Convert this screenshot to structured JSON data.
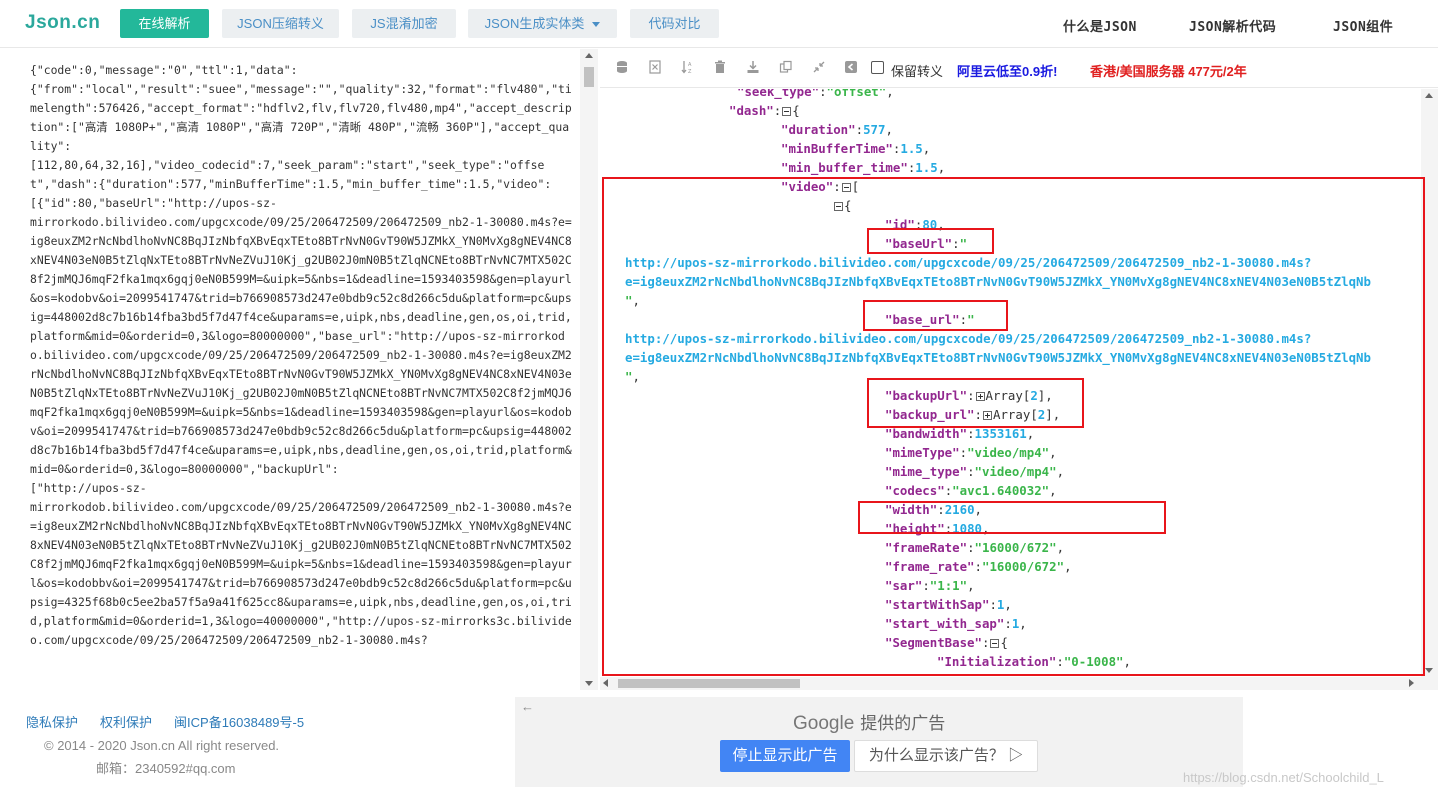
{
  "header": {
    "logo": "Json.cn",
    "nav": [
      {
        "label": "在线解析"
      },
      {
        "label": "JSON压缩转义"
      },
      {
        "label": "JS混淆加密"
      },
      {
        "label": "JSON生成实体类"
      },
      {
        "label": "代码对比"
      }
    ],
    "right_nav": [
      "什么是JSON",
      "JSON解析代码",
      "JSON组件"
    ]
  },
  "raw_json": "{\"code\":0,\"message\":\"0\",\"ttl\":1,\"data\":\n{\"from\":\"local\",\"result\":\"suee\",\"message\":\"\",\"quality\":32,\"format\":\"flv480\",\"timelength\":576426,\"accept_format\":\"hdflv2,flv,flv720,flv480,mp4\",\"accept_description\":[\"高清 1080P+\",\"高清 1080P\",\"高清 720P\",\"清晰 480P\",\"流畅 360P\"],\"accept_quality\":\n[112,80,64,32,16],\"video_codecid\":7,\"seek_param\":\"start\",\"seek_type\":\"offset\",\"dash\":{\"duration\":577,\"minBufferTime\":1.5,\"min_buffer_time\":1.5,\"video\":\n[{\"id\":80,\"baseUrl\":\"http://upos-sz-\nmirrorkodo.bilivideo.com/upgcxcode/09/25/206472509/206472509_nb2-1-30080.m4s?e=ig8euxZM2rNcNbdlhoNvNC8BqJIzNbfqXBvEqxTEto8BTrNvN0GvT90W5JZMkX_YN0MvXg8gNEV4NC8xNEV4N03eN0B5tZlqNxTEto8BTrNvNeZVuJ10Kj_g2UB02J0mN0B5tZlqNCNEto8BTrNvNC7MTX502C8f2jmMQJ6mqF2fka1mqx6gqj0eN0B599M=&uipk=5&nbs=1&deadline=1593403598&gen=playurl&os=kodobv&oi=2099541747&trid=b766908573d247e0bdb9c52c8d266c5du&platform=pc&upsig=448002d8c7b16b14fba3bd5f7d47f4ce&uparams=e,uipk,nbs,deadline,gen,os,oi,trid,platform&mid=0&orderid=0,3&logo=80000000\",\"base_url\":\"http://upos-sz-mirrorkodo.bilivideo.com/upgcxcode/09/25/206472509/206472509_nb2-1-30080.m4s?e=ig8euxZM2rNcNbdlhoNvNC8BqJIzNbfqXBvEqxTEto8BTrNvN0GvT90W5JZMkX_YN0MvXg8gNEV4NC8xNEV4N03eN0B5tZlqNxTEto8BTrNvNeZVuJ10Kj_g2UB02J0mN0B5tZlqNCNEto8BTrNvNC7MTX502C8f2jmMQJ6mqF2fka1mqx6gqj0eN0B599M=&uipk=5&nbs=1&deadline=1593403598&gen=playurl&os=kodobv&oi=2099541747&trid=b766908573d247e0bdb9c52c8d266c5du&platform=pc&upsig=448002d8c7b16b14fba3bd5f7d47f4ce&uparams=e,uipk,nbs,deadline,gen,os,oi,trid,platform&mid=0&orderid=0,3&logo=80000000\",\"backupUrl\":\n[\"http://upos-sz-\nmirrorkodob.bilivideo.com/upgcxcode/09/25/206472509/206472509_nb2-1-30080.m4s?e=ig8euxZM2rNcNbdlhoNvNC8BqJIzNbfqXBvEqxTEto8BTrNvN0GvT90W5JZMkX_YN0MvXg8gNEV4NC8xNEV4N03eN0B5tZlqNxTEto8BTrNvNeZVuJ10Kj_g2UB02J0mN0B5tZlqNCNEto8BTrNvNC7MTX502C8f2jmMQJ6mqF2fka1mqx6gqj0eN0B599M=&uipk=5&nbs=1&deadline=1593403598&gen=playurl&os=kodobbv&oi=2099541747&trid=b766908573d247e0bdb9c52c8d266c5du&platform=pc&upsig=4325f68b0c5ee2ba57f5a9a41f625cc8&uparams=e,uipk,nbs,deadline,gen,os,oi,trid,platform&mid=0&orderid=1,3&logo=40000000\",\"http://upos-sz-mirrorks3c.bilivideo.com/upgcxcode/09/25/206472509/206472509_nb2-1-30080.m4s?",
  "toolbar": {
    "checkbox_label": "保留转义",
    "ad_blue": "阿里云低至0.9折!",
    "ad_red": "香港/美国服务器 477元/2年"
  },
  "tree": {
    "seek_type_key": "\"seek_type\"",
    "seek_type_val": "\"offset\"",
    "dash_key": "\"dash\"",
    "duration_key": "\"duration\"",
    "duration_val": "577",
    "minBufferTime_key": "\"minBufferTime\"",
    "minBufferTime_val": "1.5",
    "min_buffer_time_key": "\"min_buffer_time\"",
    "min_buffer_time_val": "1.5",
    "video_key": "\"video\"",
    "id_key": "\"id\"",
    "id_val": "80",
    "baseUrl_key": "\"baseUrl\"",
    "url_line1": "http://upos-sz-mirrorkodo.bilivideo.com/upgcxcode/09/25/206472509/206472509_nb2-1-30080.m4s?",
    "url_line2": "e=ig8euxZM2rNcNbdlhoNvNC8BqJIzNbfqXBvEqxTEto8BTrNvN0GvT90W5JZMkX_YN0MvXg8gNEV4NC8xNEV4N03eN0B5tZlqNb",
    "base_url_key": "\"base_url\"",
    "url2_line1": "http://upos-sz-mirrorkodo.bilivideo.com/upgcxcode/09/25/206472509/206472509_nb2-1-30080.m4s?",
    "url2_line2": "e=ig8euxZM2rNcNbdlhoNvNC8BqJIzNbfqXBvEqxTEto8BTrNvN0GvT90W5JZMkX_YN0MvXg8gNEV4NC8xNEV4N03eN0B5tZlqNb",
    "backupUrl_key": "\"backupUrl\"",
    "backup_url_key": "\"backup_url\"",
    "array_label": "Array",
    "array_count": "2",
    "bandwidth_key": "\"bandwidth\"",
    "bandwidth_val": "1353161",
    "mimeType_key": "\"mimeType\"",
    "mimeType_val": "\"video/mp4\"",
    "mime_type_key": "\"mime_type\"",
    "mime_type_val": "\"video/mp4\"",
    "codecs_key": "\"codecs\"",
    "codecs_val": "\"avc1.640032\"",
    "width_key": "\"width\"",
    "width_val": "2160",
    "height_key": "\"height\"",
    "height_val": "1080",
    "frameRate_key": "\"frameRate\"",
    "frameRate_val": "\"16000/672\"",
    "frame_rate_key": "\"frame_rate\"",
    "frame_rate_val": "\"16000/672\"",
    "sar_key": "\"sar\"",
    "sar_val": "\"1:1\"",
    "startWithSap_key": "\"startWithSap\"",
    "startWithSap_val": "1",
    "start_with_sap_key": "\"start_with_sap\"",
    "start_with_sap_val": "1",
    "SegmentBase_key": "\"SegmentBase\"",
    "Initialization_key": "\"Initialization\"",
    "Initialization_val": "\"0-1008\""
  },
  "footer": {
    "links": [
      "隐私保护",
      "权利保护",
      "闽ICP备16038489号-5"
    ],
    "copyright": "© 2014 - 2020 Json.cn All right reserved.",
    "email": "邮箱：2340592#qq.com"
  },
  "ad": {
    "google": "Google",
    "provided": "提供的广告",
    "stop": "停止显示此广告",
    "why": "为什么显示该广告？"
  },
  "watermark": "https://blog.csdn.net/Schoolchild_L",
  "colors": {
    "accent": "#23b89a",
    "key": "#92278f",
    "string": "#3ab54a",
    "number": "#25aae1",
    "annotation": "#e8151b"
  }
}
